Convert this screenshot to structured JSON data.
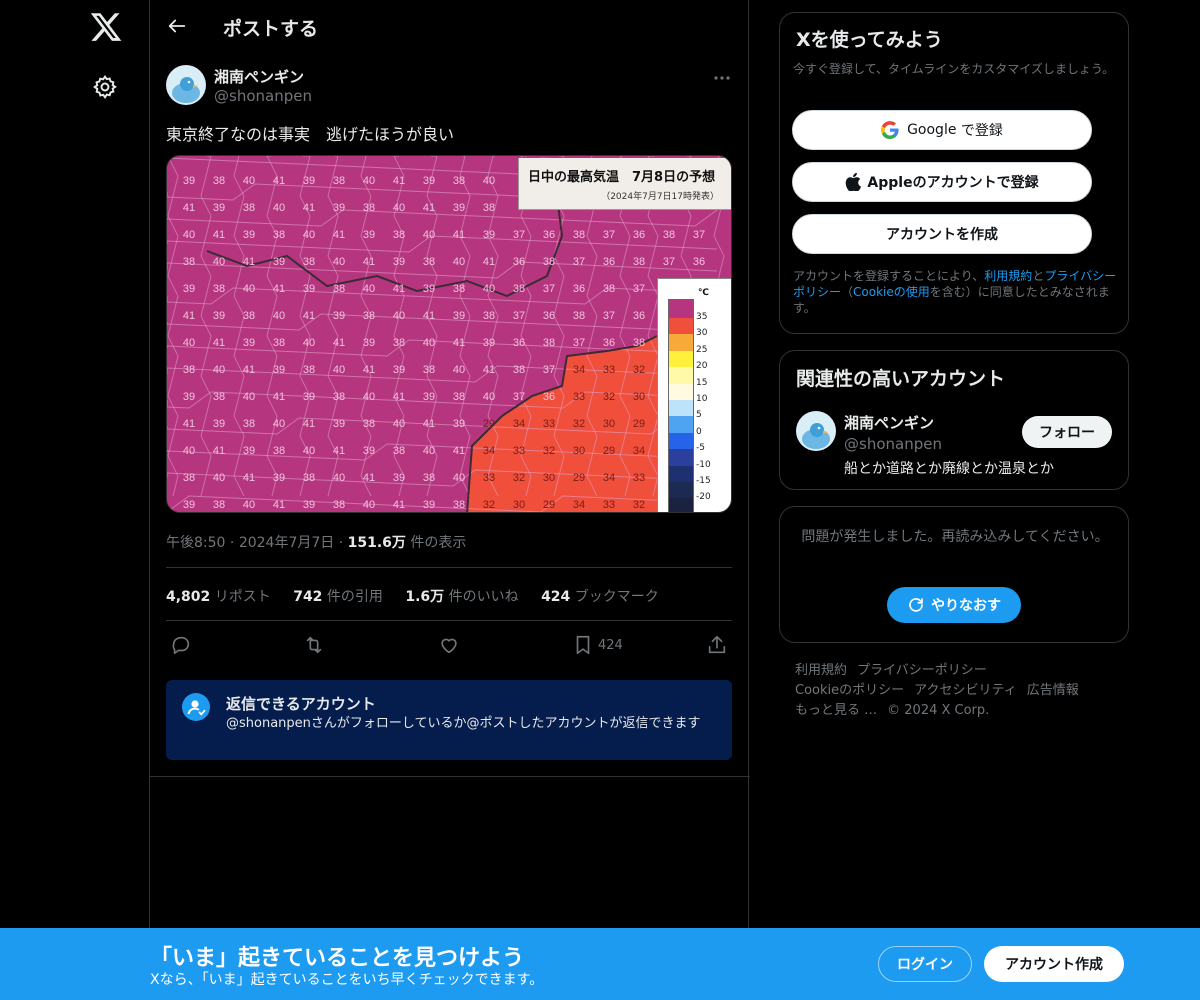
{
  "header": {
    "title": "ポストする"
  },
  "post": {
    "display_name": "湘南ペンギン",
    "handle": "@shonanpen",
    "text": "東京終了なのは事実　逃げたほうが良い",
    "time": "午後8:50",
    "date": "2024年7月7日",
    "views_count": "151.6万",
    "views_label": "件の表示",
    "sep": "·",
    "stats": [
      {
        "n": "4,802",
        "label": "リポスト"
      },
      {
        "n": "742",
        "label": "件の引用"
      },
      {
        "n": "1.6万",
        "label": "件のいいね"
      },
      {
        "n": "424",
        "label": "ブックマーク"
      }
    ],
    "bookmark_count": "424",
    "media": {
      "title": "日中の最高気温　7月8日の予想",
      "subtitle": "（2024年7月7日17時発表）",
      "legend_unit": "℃",
      "legend_labels": [
        "35",
        "30",
        "25",
        "20",
        "15",
        "10",
        "5",
        "0",
        "-5",
        "-10",
        "-15",
        "-20"
      ],
      "legend_colors": [
        "#b5367f",
        "#f04f3c",
        "#f7a93a",
        "#fff03c",
        "#fff9a8",
        "#fffae0",
        "#bde3fa",
        "#4fa4f2",
        "#2563e8",
        "#2a3f9e",
        "#1e3070",
        "#1c2a52",
        "#1a2240"
      ],
      "cell_values": [
        "39",
        "38",
        "37",
        "36",
        "40",
        "41",
        "34",
        "33",
        "32",
        "30",
        "29"
      ]
    }
  },
  "reply_box": {
    "title": "返信できるアカウント",
    "desc": "@shonanpenさんがフォローしているか@ポストしたアカウントが返信できます"
  },
  "signup_card": {
    "title": "Xを使ってみよう",
    "subtitle": "今すぐ登録して、タイムラインをカスタマイズしましょう。",
    "google_btn_brand": "Google",
    "google_btn_suffix": "で登録",
    "apple_btn": "Appleのアカウントで登録",
    "create_btn": "アカウントを作成",
    "legal_1": "アカウントを登録することにより、",
    "legal_terms": "利用規約",
    "legal_and": "と",
    "legal_privacy": "プライバシーポリシー",
    "legal_2": "（",
    "legal_cookie": "Cookieの使用",
    "legal_3": "を含む）に同意したとみなされます。"
  },
  "related_card": {
    "title": "関連性の高いアカウント",
    "name": "湘南ペンギン",
    "handle": "@shonanpen",
    "bio": "船とか道路とか廃線とか温泉とか",
    "follow_btn": "フォロー"
  },
  "error_card": {
    "message": "問題が発生しました。再読み込みしてください。",
    "retry_btn": "やりなおす"
  },
  "footer": {
    "links": [
      "利用規約",
      "プライバシーポリシー",
      "Cookieのポリシー",
      "アクセシビリティ",
      "広告情報",
      "もっと見る …",
      "© 2024 X Corp."
    ]
  },
  "banner": {
    "title": "「いま」起きていることを見つけよう",
    "subtitle": "Xなら、「いま」起きていることをいち早くチェックできます。",
    "login_btn": "ログイン",
    "signup_btn": "アカウント作成"
  },
  "colors": {
    "accent": "#1d9bf0",
    "banner": "#1d9bf0",
    "reply_box": "#051d4d",
    "map_hot": "#b5367f",
    "map_warm": "#f04f3c"
  },
  "icons": [
    "x-logo-icon",
    "gear-icon",
    "back-arrow-icon",
    "more-icon",
    "reply-icon",
    "repost-icon",
    "like-icon",
    "bookmark-icon",
    "share-icon",
    "user-check-icon",
    "google-icon",
    "apple-icon",
    "refresh-icon"
  ]
}
